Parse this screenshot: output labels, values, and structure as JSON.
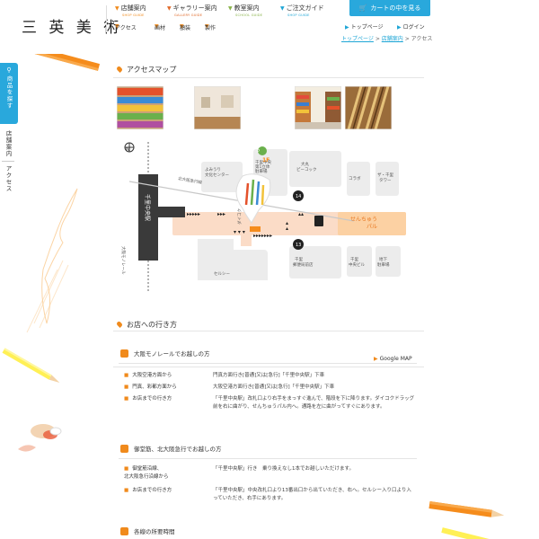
{
  "header": {
    "logo": "三 英 美 術",
    "nav": [
      {
        "label": "店舗案内",
        "en": "SHOP GUIDE"
      },
      {
        "label": "ギャラリー案内",
        "en": "GALLERY GUIDE"
      },
      {
        "label": "教室案内",
        "en": "SCHOOL GUIDE"
      },
      {
        "label": "ご注文ガイド",
        "en": "SHOP GUIDE"
      }
    ],
    "subnav": [
      "アクセス",
      "画材",
      "額装",
      "製作"
    ],
    "cart_label": "カートの中を見る",
    "top_link": "トップページ",
    "login_link": "ログイン"
  },
  "breadcrumb": {
    "items": [
      "トップページ",
      "店舗案内"
    ],
    "current": "アクセス",
    "sep": ">"
  },
  "side": {
    "search_label": "商品を探す",
    "store_label": "店舗案内",
    "access_label": "アクセス"
  },
  "access_map": {
    "title": "アクセスマップ",
    "google_label": "Google MAP",
    "map": {
      "north": "N",
      "station": "千里中央駅",
      "monorail": "大阪モノレール",
      "kitakyu": "北大阪急行線",
      "yomiuri": "よみうり\n文化センター",
      "parking": "千里中央\n第1立体\n駐車場",
      "parking_badge": "P",
      "daimaru": "大丸\nピーコック",
      "korabo": "コラボ",
      "tower": "ザ・千里\nタワー",
      "senchu": "せんちゅう\nパル",
      "floor": "1F",
      "daikoku": "ダイコク",
      "exit14": "14",
      "exit13": "13",
      "sercy": "セルシー",
      "senri_post": "千里\n郵便局前店",
      "senri_bldg": "千里\n中央ビル",
      "chika": "地下\n駐車場"
    }
  },
  "directions": {
    "title": "お店への行き方",
    "groups": [
      {
        "title": "大阪モノレールでお越しの方",
        "rows": [
          {
            "label": "大阪空港方面から",
            "text": "門真方面行き[普通]又は[急行]「千里中央駅」下車"
          },
          {
            "label": "門真、彩都方面から",
            "text": "大阪空港方面行き[普通]又は[急行]「千里中央駅」下車"
          },
          {
            "label": "お店までの行き方",
            "text": "「千里中央駅」改札口より右手をまっすぐ進んで、階段を下に降ります。ダイコクドラッグ前を右に曲がり、せんちゅうパル内へ。通路を左に曲がってすぐにあります。"
          }
        ]
      },
      {
        "title": "御堂筋、北大阪急行でお越しの方",
        "rows": [
          {
            "label": "御堂筋沿線、\n北大阪急行沿線から",
            "text": "「千里中央駅」行き　乗り換えなし1本でお越しいただけます。"
          },
          {
            "label": "お店までの行き方",
            "text": "「千里中央駅」中央改札口より13番出口から出ていただき、右へ。セルシー入り口より入っていただき、右手にあります。"
          }
        ]
      },
      {
        "title": "各線の所要時間",
        "rows": []
      }
    ]
  },
  "colors": {
    "accent": "#f08a1c",
    "blue": "#29a8dc",
    "map_path": "#fbdcc7"
  }
}
